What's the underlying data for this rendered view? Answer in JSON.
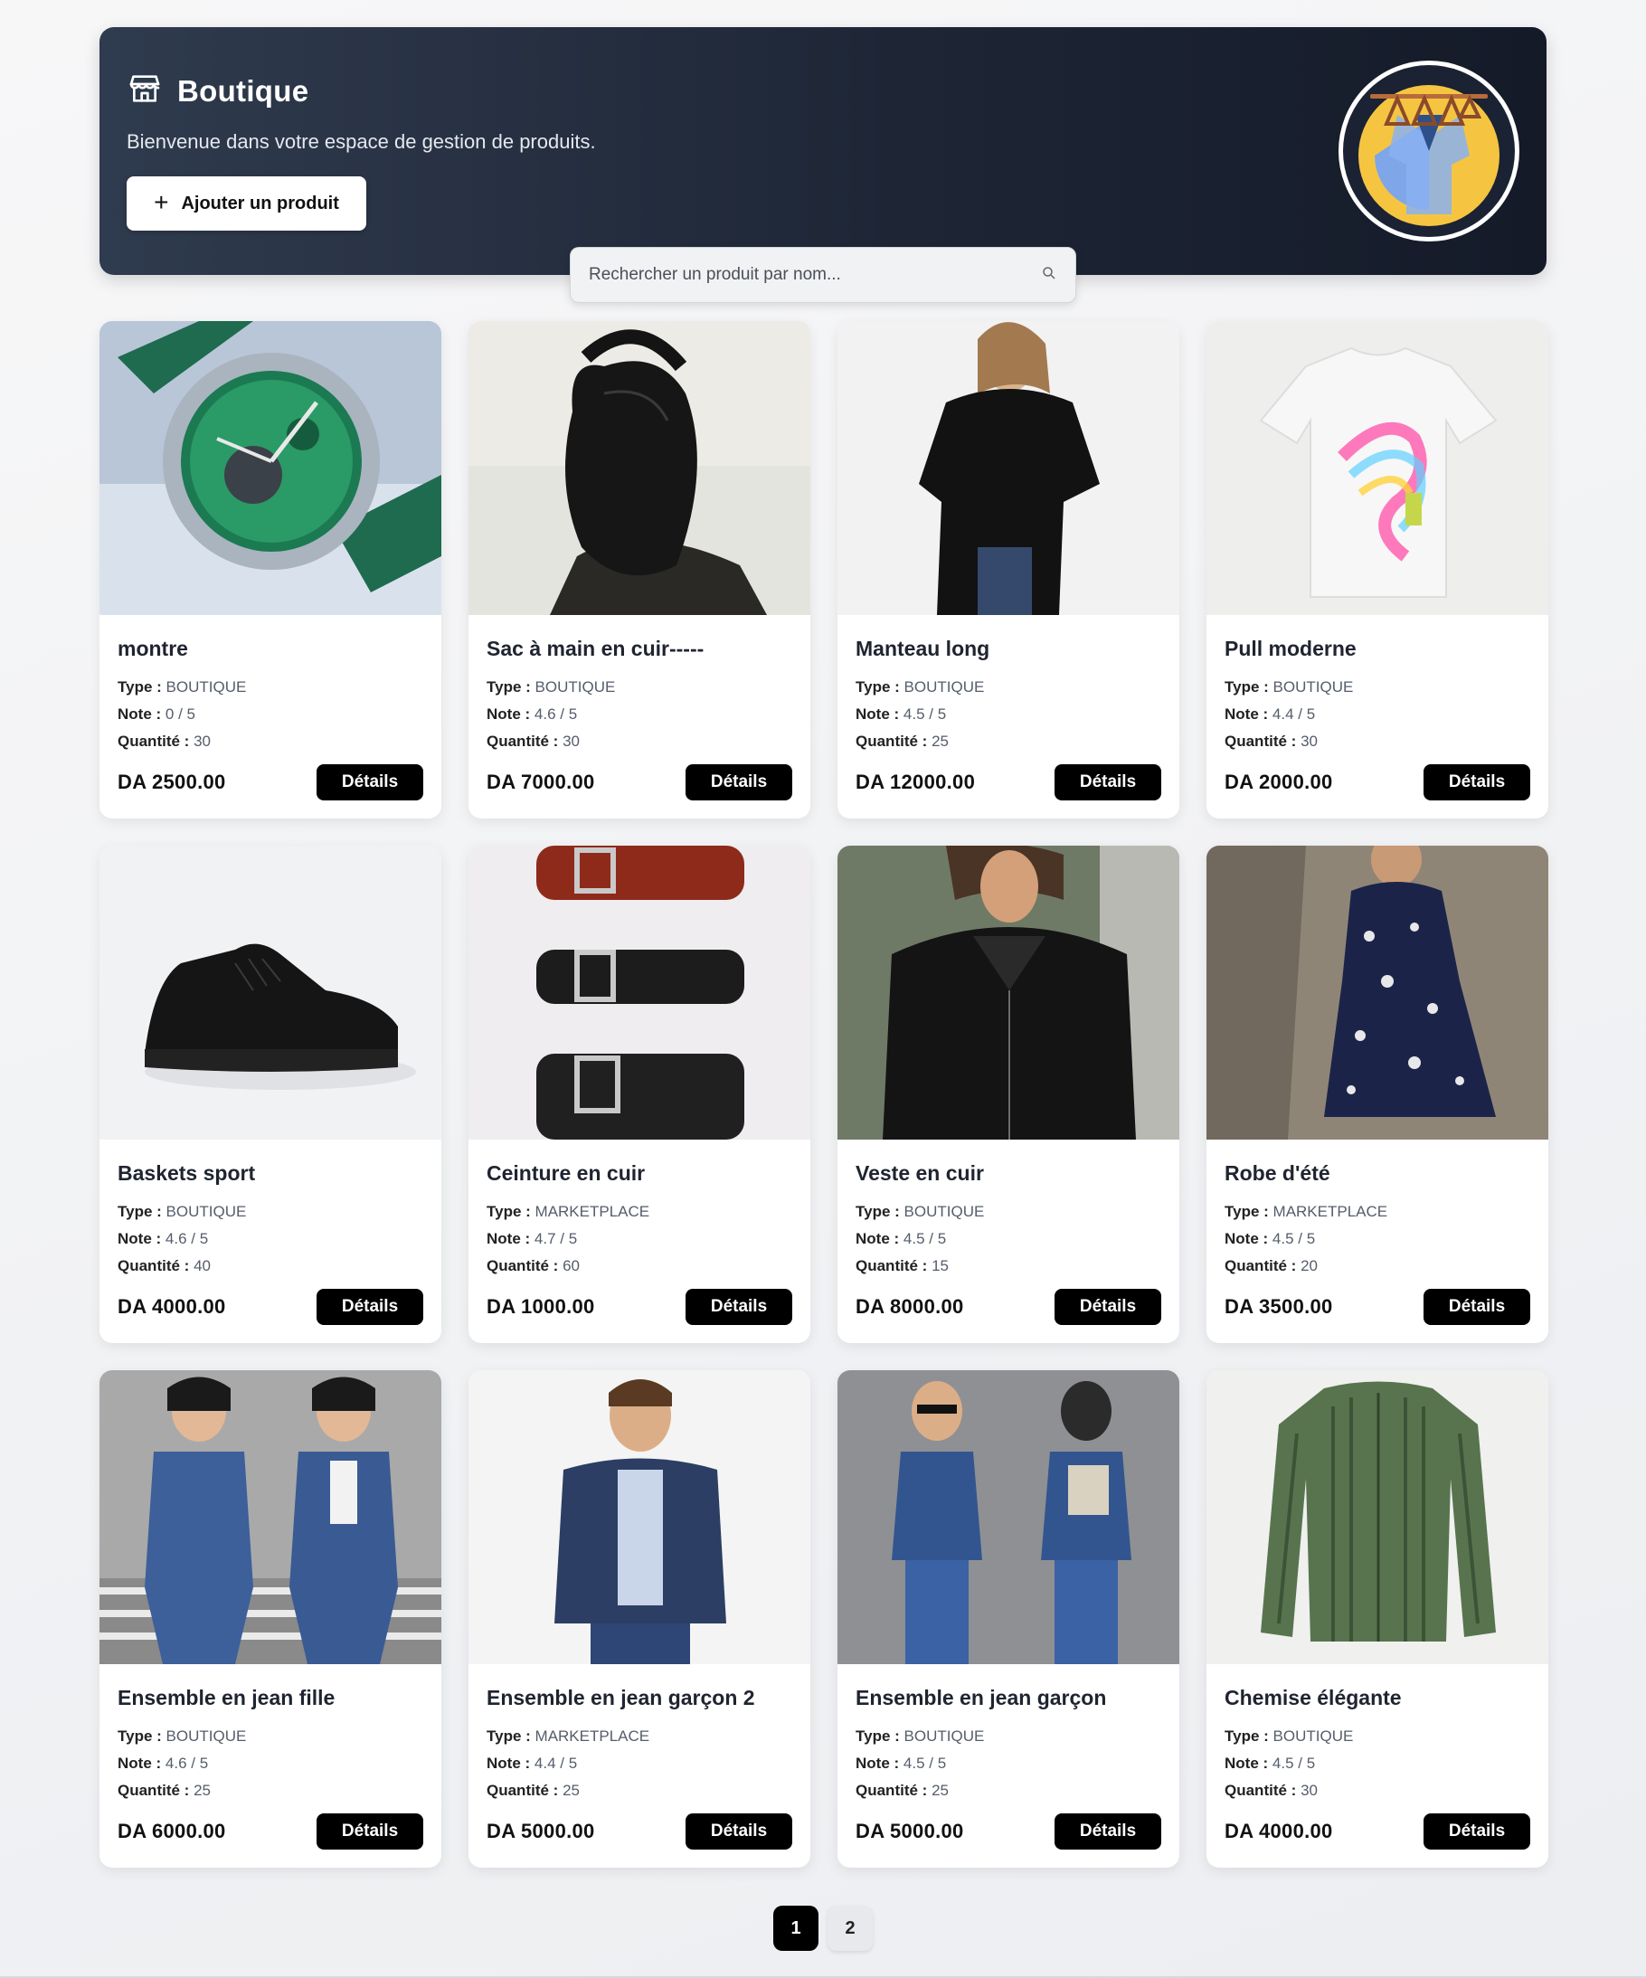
{
  "header": {
    "title": "Boutique",
    "subtitle": "Bienvenue dans votre espace de gestion de produits.",
    "add_button_label": "Ajouter un produit",
    "add_button_icon": "plus-icon",
    "title_icon": "store-icon",
    "logo": "clothing-rack-logo"
  },
  "search": {
    "placeholder": "Rechercher un produit par nom...",
    "icon": "search-icon"
  },
  "labels": {
    "type": "Type",
    "note": "Note",
    "quantity": "Quantité",
    "details": "Détails"
  },
  "products": [
    {
      "name": "montre",
      "type": "BOUTIQUE",
      "note": "0 / 5",
      "quantity": "30",
      "price": "DA 2500.00",
      "image": "watch-image"
    },
    {
      "name": "Sac à main en cuir-----",
      "type": "BOUTIQUE",
      "note": "4.6 / 5",
      "quantity": "30",
      "price": "DA 7000.00",
      "image": "handbag-image"
    },
    {
      "name": "Manteau long",
      "type": "BOUTIQUE",
      "note": "4.5 / 5",
      "quantity": "25",
      "price": "DA 12000.00",
      "image": "long-coat-image"
    },
    {
      "name": "Pull moderne",
      "type": "BOUTIQUE",
      "note": "4.4 / 5",
      "quantity": "30",
      "price": "DA 2000.00",
      "image": "tshirt-image"
    },
    {
      "name": "Baskets sport",
      "type": "BOUTIQUE",
      "note": "4.6 / 5",
      "quantity": "40",
      "price": "DA 4000.00",
      "image": "sneaker-image"
    },
    {
      "name": "Ceinture en cuir",
      "type": "MARKETPLACE",
      "note": "4.7 / 5",
      "quantity": "60",
      "price": "DA 1000.00",
      "image": "belts-image"
    },
    {
      "name": "Veste en cuir",
      "type": "BOUTIQUE",
      "note": "4.5 / 5",
      "quantity": "15",
      "price": "DA 8000.00",
      "image": "leather-jacket-image"
    },
    {
      "name": "Robe d'été",
      "type": "MARKETPLACE",
      "note": "4.5 / 5",
      "quantity": "20",
      "price": "DA 3500.00",
      "image": "summer-dress-image"
    },
    {
      "name": "Ensemble en jean fille",
      "type": "BOUTIQUE",
      "note": "4.6 / 5",
      "quantity": "25",
      "price": "DA 6000.00",
      "image": "girls-denim-image"
    },
    {
      "name": "Ensemble en jean garçon 2",
      "type": "MARKETPLACE",
      "note": "4.4 / 5",
      "quantity": "25",
      "price": "DA 5000.00",
      "image": "boy-denim-jacket-image"
    },
    {
      "name": "Ensemble en jean garçon",
      "type": "BOUTIQUE",
      "note": "4.5 / 5",
      "quantity": "25",
      "price": "DA 5000.00",
      "image": "boys-denim-set-image"
    },
    {
      "name": "Chemise élégante",
      "type": "BOUTIQUE",
      "note": "4.5 / 5",
      "quantity": "30",
      "price": "DA 4000.00",
      "image": "green-shirt-image"
    }
  ],
  "pagination": {
    "pages": [
      "1",
      "2"
    ],
    "active": "1"
  },
  "colors": {
    "header_bg": "#1e2636",
    "button_dark": "#000000",
    "page_bg": "#eceef1"
  }
}
